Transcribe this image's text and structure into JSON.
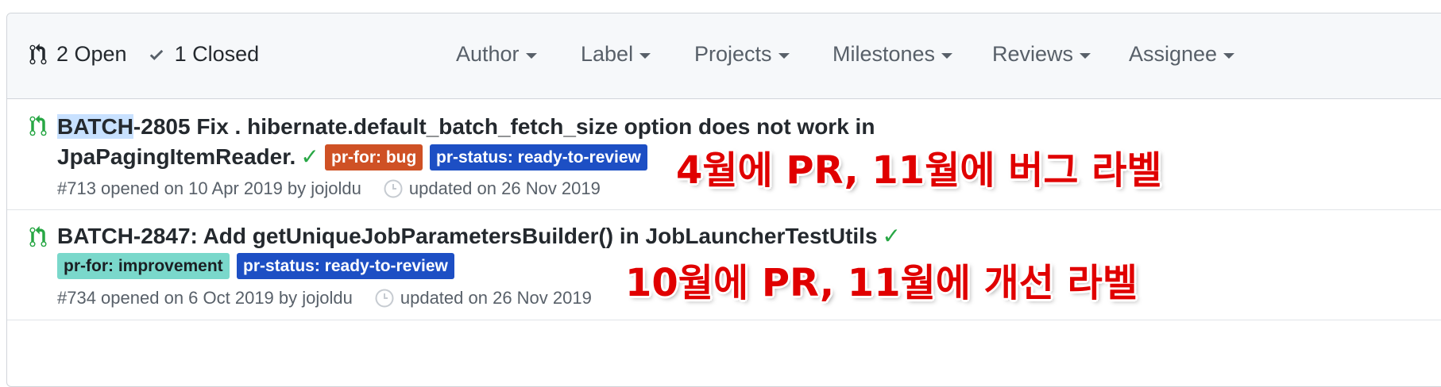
{
  "header": {
    "open_label": "2 Open",
    "closed_label": "1 Closed",
    "filters": [
      "Author",
      "Label",
      "Projects",
      "Milestones",
      "Reviews",
      "Assignee"
    ]
  },
  "pulls": [
    {
      "title_highlight": "BATCH",
      "title_line1_rest": "-2805 Fix . hibernate.default_batch_fetch_size option does not work in",
      "title_line2": "JpaPagingItemReader.",
      "status_check": "✓",
      "labels": [
        {
          "text": "pr-for: bug",
          "bg": "#cf5125",
          "fg": "#ffffff"
        },
        {
          "text": "pr-status: ready-to-review",
          "bg": "#1d4fc4",
          "fg": "#ffffff"
        }
      ],
      "opened": "#713 opened on 10 Apr 2019 by jojoldu",
      "updated": "updated on 26 Nov 2019",
      "annotation": "4월에 PR, 11월에 버그 라벨"
    },
    {
      "title": "BATCH-2847: Add getUniqueJobParametersBuilder() in JobLauncherTestUtils",
      "status_check": "✓",
      "labels": [
        {
          "text": "pr-for: improvement",
          "bg": "#7ad8cb",
          "fg": "#1b1f23"
        },
        {
          "text": "pr-status: ready-to-review",
          "bg": "#1d4fc4",
          "fg": "#ffffff"
        }
      ],
      "opened": "#734 opened on 6 Oct 2019 by jojoldu",
      "updated": "updated on 26 Nov 2019",
      "annotation": "10월에 PR, 11월에 개선 라벨"
    }
  ],
  "colors": {
    "open_icon": "#28a745",
    "annotation": "#e00000"
  }
}
